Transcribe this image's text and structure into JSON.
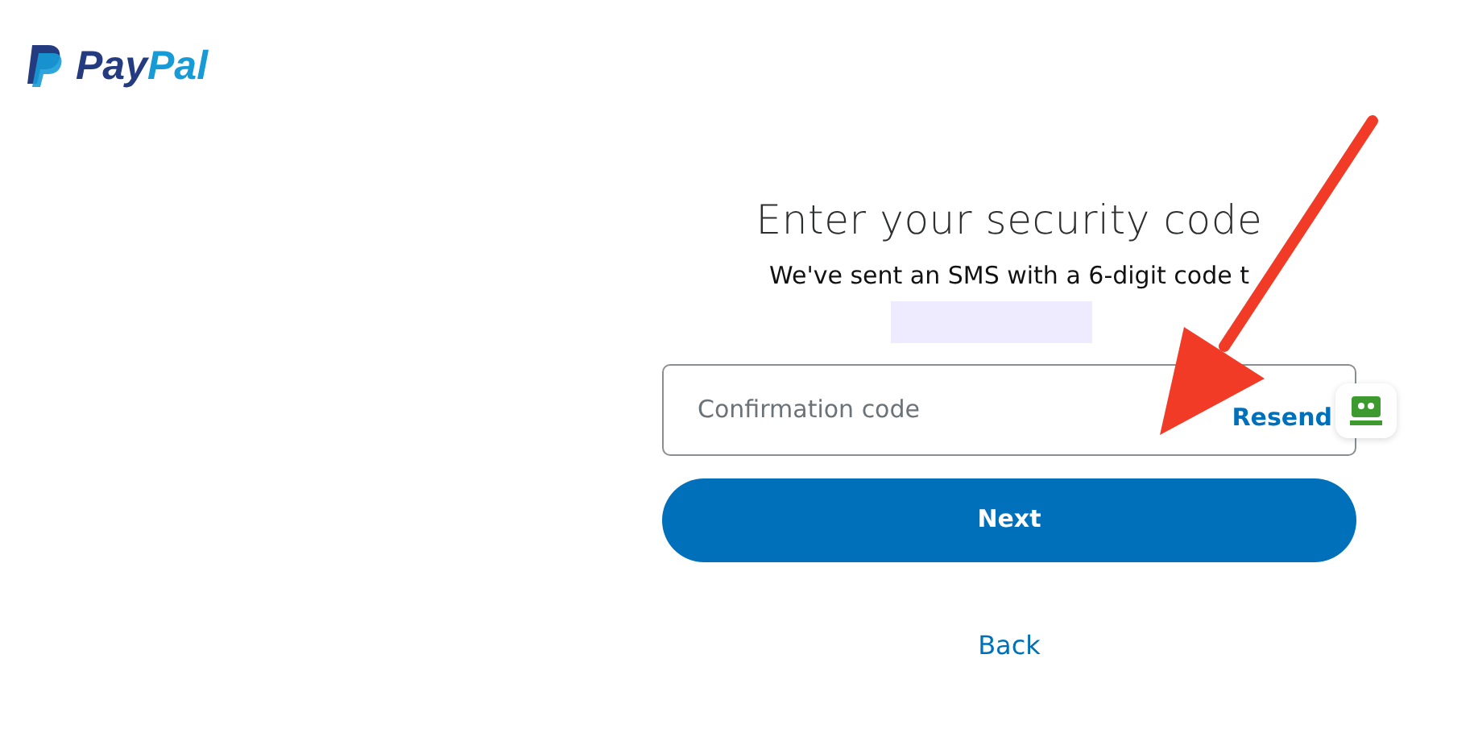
{
  "logo": {
    "text_dark": "Pay",
    "text_light": "Pal"
  },
  "heading": "Enter your security code",
  "subtitle": "We've sent an SMS with a 6-digit code t",
  "code_field": {
    "placeholder": "Confirmation code",
    "action": "Resend"
  },
  "buttons": [
    {
      "label": "Next",
      "kind": "primary"
    },
    {
      "label": "Back",
      "kind": "link"
    }
  ]
}
